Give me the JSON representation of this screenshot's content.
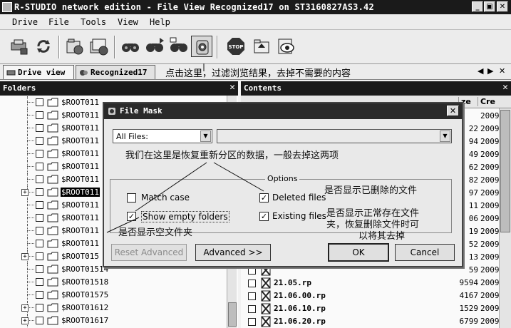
{
  "window": {
    "title": "R-STUDIO network edition - File View Recognized17 on ST3160827AS3.42",
    "min_label": "_",
    "max_label": "▣",
    "close_label": "✕"
  },
  "menu": {
    "items": [
      {
        "label": "Drive"
      },
      {
        "label": "File"
      },
      {
        "label": "Tools"
      },
      {
        "label": "View"
      },
      {
        "label": "Help"
      }
    ]
  },
  "tabs": {
    "items": [
      {
        "label": "Drive view"
      },
      {
        "label": "Recognized17"
      }
    ],
    "annotation": "点击这里，过滤浏览结果，去掉不需要的内容",
    "nav": [
      "◀",
      "▶",
      "✕"
    ]
  },
  "folders": {
    "header": "Folders",
    "close_label": "✕",
    "rows": [
      {
        "label": "$ROOT011",
        "expander": ""
      },
      {
        "label": "$ROOT011",
        "expander": ""
      },
      {
        "label": "$ROOT011",
        "expander": ""
      },
      {
        "label": "$ROOT011",
        "expander": ""
      },
      {
        "label": "$ROOT011",
        "expander": ""
      },
      {
        "label": "$ROOT011",
        "expander": ""
      },
      {
        "label": "$ROOT011",
        "expander": ""
      },
      {
        "label": "$ROOT011",
        "expander": "+"
      },
      {
        "label": "$ROOT011",
        "expander": ""
      },
      {
        "label": "$ROOT011",
        "expander": ""
      },
      {
        "label": "$ROOT011",
        "expander": ""
      },
      {
        "label": "$ROOT011",
        "expander": ""
      },
      {
        "label": "$ROOT015",
        "expander": "+"
      },
      {
        "label": "$ROOT01514",
        "expander": ""
      },
      {
        "label": "$ROOT01518",
        "expander": ""
      },
      {
        "label": "$ROOT01575",
        "expander": ""
      },
      {
        "label": "$ROOT01612",
        "expander": "+"
      },
      {
        "label": "$ROOT01617",
        "expander": "+"
      }
    ]
  },
  "contents": {
    "header": "Contents",
    "close_label": "✕",
    "columns": {
      "size": "ze",
      "created": "Cre"
    },
    "rows": [
      {
        "name": "",
        "size": "",
        "created": "2009"
      },
      {
        "name": "",
        "size": "22",
        "created": "2009"
      },
      {
        "name": "",
        "size": "94",
        "created": "2009"
      },
      {
        "name": "",
        "size": "49",
        "created": "2009"
      },
      {
        "name": "",
        "size": "62",
        "created": "2009"
      },
      {
        "name": "",
        "size": "82",
        "created": "2009"
      },
      {
        "name": "",
        "size": "97",
        "created": "2009"
      },
      {
        "name": "",
        "size": "11",
        "created": "2009"
      },
      {
        "name": "",
        "size": "06",
        "created": "2009"
      },
      {
        "name": "",
        "size": "19",
        "created": "2009"
      },
      {
        "name": "",
        "size": "52",
        "created": "2009"
      },
      {
        "name": "",
        "size": "13",
        "created": "2009"
      },
      {
        "name": "",
        "size": "59",
        "created": "2009"
      },
      {
        "name": "21.05.rp",
        "size": "9594",
        "created": "2009"
      },
      {
        "name": "21.06.00.rp",
        "size": "4167",
        "created": "2009"
      },
      {
        "name": "21.06.10.rp",
        "size": "1529",
        "created": "2009"
      },
      {
        "name": "21.06.20.rp",
        "size": "6799",
        "created": "2009"
      }
    ]
  },
  "dialog": {
    "title": "File Mask",
    "close_label": "✕",
    "filter_select": "All Files:",
    "mask_input": "",
    "options_legend": "Options",
    "match_case": "Match case",
    "show_empty_folders": "Show empty folders",
    "deleted_files": "Deleted files",
    "existing_files": "Existing files",
    "reset_advanced": "Reset Advanced",
    "advanced": "Advanced >>",
    "ok": "OK",
    "cancel": "Cancel",
    "checks": {
      "match_case": false,
      "show_empty_folders": true,
      "deleted_files": true,
      "existing_files": true
    }
  },
  "annotations": {
    "recovered_data_note": "我们在这里是恢复重新分区的数据，一般去掉这两项",
    "deleted_note": "是否显示已删除的文件",
    "existing_note_1": "是否显示正常存在文件",
    "existing_note_2": "夹，恢复删除文件时可",
    "existing_note_3": "以将其去掉",
    "empty_folder_note": "是否显示空文件夹"
  }
}
